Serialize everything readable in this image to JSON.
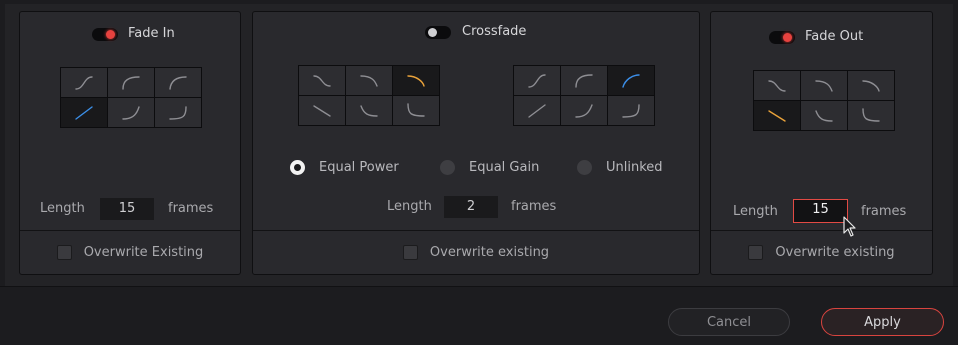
{
  "fade_in": {
    "title": "Fade In",
    "enabled": true,
    "length_label": "Length",
    "length_value": "15",
    "units": "frames",
    "overwrite_label": "Overwrite Existing",
    "curves": [
      "ease-in",
      "ease-out",
      "ease-out-steep",
      "linear",
      "ease-in-late",
      "s-end"
    ],
    "selected_curve": 3
  },
  "crossfade": {
    "title": "Crossfade",
    "enabled": false,
    "out_curves": [
      "fade-out-s",
      "fade-out-round",
      "fade-out-curve",
      "fade-out-linear",
      "fade-out-dip",
      "fade-out-corner"
    ],
    "out_selected": 2,
    "in_curves": [
      "fade-in-s",
      "fade-in-round",
      "fade-in-curve",
      "fade-in-linear",
      "fade-in-dip",
      "fade-in-corner"
    ],
    "in_selected": 2,
    "options": [
      {
        "label": "Equal Power",
        "selected": true
      },
      {
        "label": "Equal Gain",
        "selected": false
      },
      {
        "label": "Unlinked",
        "selected": false
      }
    ],
    "length_label": "Length",
    "length_value": "2",
    "units": "frames",
    "overwrite_label": "Overwrite existing"
  },
  "fade_out": {
    "title": "Fade Out",
    "enabled": true,
    "length_label": "Length",
    "length_value": "15",
    "units": "frames",
    "overwrite_label": "Overwrite existing",
    "curves": [
      "fade-out-s",
      "fade-out-round",
      "fade-out-curve",
      "fade-out-linear",
      "fade-out-dip",
      "fade-out-corner"
    ],
    "selected_curve": 3
  },
  "footer": {
    "cancel_label": "Cancel",
    "apply_label": "Apply"
  },
  "colors": {
    "accent_red": "#e7423f",
    "curve_blue": "#3b8ee8",
    "curve_orange": "#e9a23a",
    "curve_grey": "#8e8e93"
  }
}
